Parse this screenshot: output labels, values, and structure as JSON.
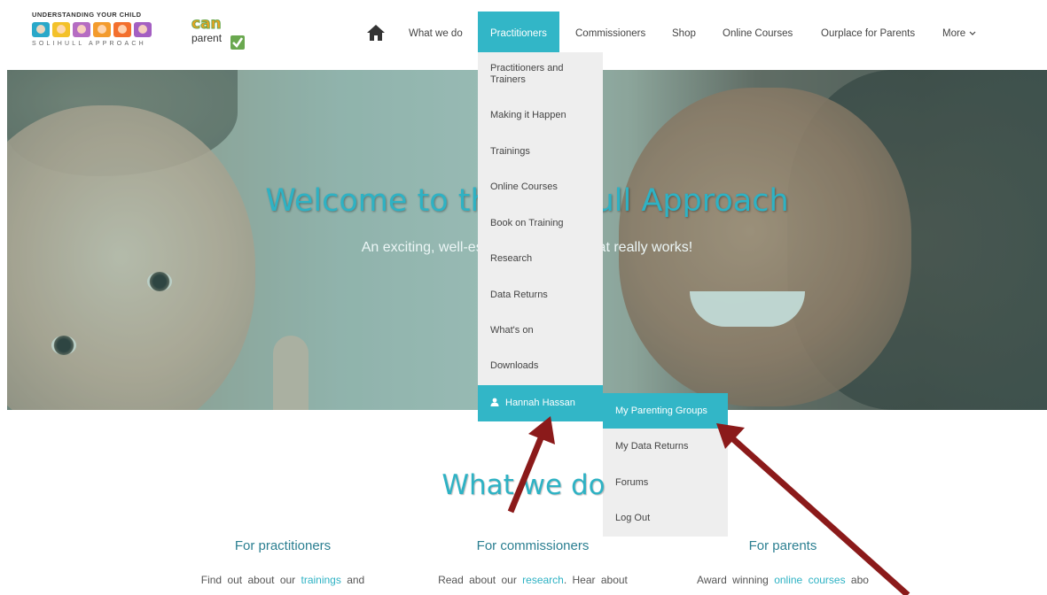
{
  "logos": {
    "uyc_line1": "UNDERSTANDING YOUR CHILD",
    "uyc_line2": "SOLIHULL APPROACH",
    "uyc_tile_colors": [
      "#2aa8c9",
      "#f3c12a",
      "#b56cc2",
      "#f39b2d",
      "#f36f2d",
      "#a45fc2"
    ],
    "cp_can": "can",
    "cp_parent": "parent"
  },
  "nav": {
    "items": [
      "What we do",
      "Practitioners",
      "Commissioners",
      "Shop",
      "Online Courses",
      "Ourplace for Parents",
      "More"
    ]
  },
  "hero": {
    "title": "Welcome to the Solihull Approach",
    "subtitle": "An exciting, well-established model that really works!"
  },
  "dropdown": {
    "items": [
      "Practitioners and Trainers",
      "Making it Happen",
      "Trainings",
      "Online Courses",
      "Book on Training",
      "Research",
      "Data Returns",
      "What's on",
      "Downloads"
    ],
    "user": "Hannah Hassan"
  },
  "submenu": {
    "items": [
      "My Parenting Groups",
      "My Data Returns",
      "Forums",
      "Log Out"
    ]
  },
  "section": {
    "title": "What we do",
    "columns": [
      {
        "heading": "For practitioners",
        "text_pre": "Find out about our ",
        "link": "trainings",
        "text_post": " and"
      },
      {
        "heading": "For commissioners",
        "text_pre": "Read about our ",
        "link": "research",
        "text_post": ". Hear about"
      },
      {
        "heading": "For parents",
        "text_pre": "Award winning ",
        "link": "online courses",
        "text_post": " abo"
      }
    ]
  },
  "colors": {
    "accent": "#32b6c7",
    "arrow": "#8b1a1a",
    "dropdown_bg": "#eeeeee"
  }
}
